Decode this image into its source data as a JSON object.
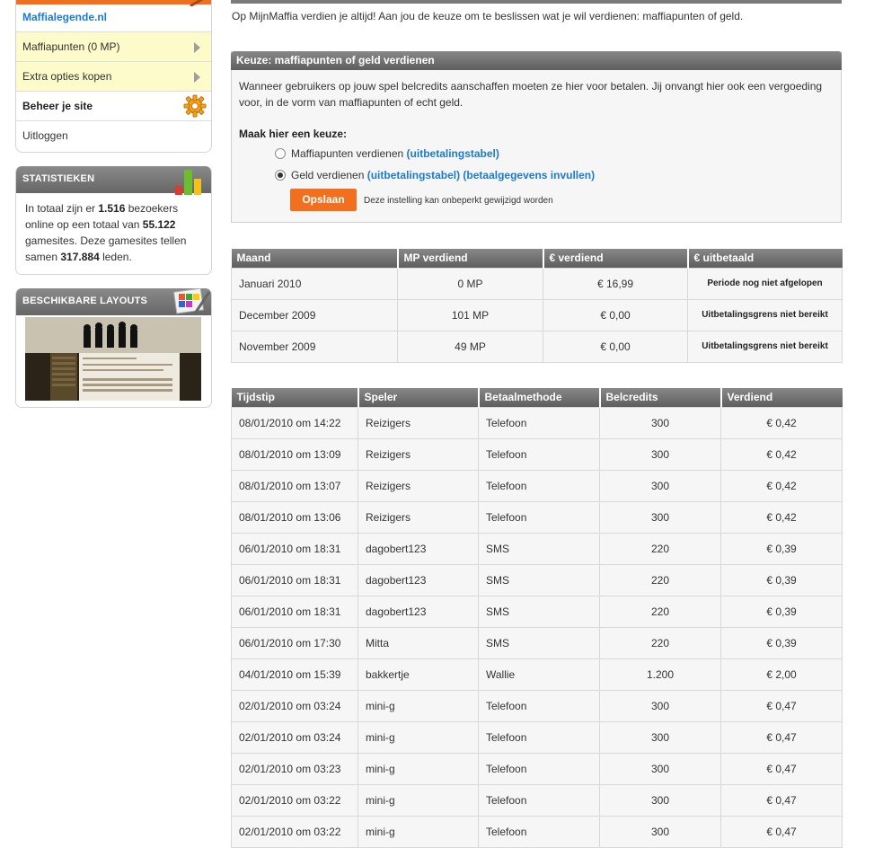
{
  "sidebar": {
    "site_name": "Maffialegende.nl",
    "nav": [
      {
        "label": "Maffiapunten (0 MP)",
        "style": "yellow",
        "icon": "arrow-right-icon"
      },
      {
        "label": "Extra opties kopen",
        "style": "yellow",
        "icon": "arrow-right-icon"
      },
      {
        "label": "Beheer je site",
        "style": "bold",
        "icon": "gear-icon"
      },
      {
        "label": "Uitloggen",
        "style": "plain",
        "icon": ""
      }
    ],
    "stats": {
      "title": "STATISTIEKEN",
      "t1": "In totaal zijn er ",
      "visitors": "1.516",
      "t2": " bezoekers online op een totaal van ",
      "sites": "55.122",
      "t3": " gamesites. Deze gamesites tellen samen ",
      "members": "317.884",
      "t4": " leden."
    },
    "layouts": {
      "title": "BESCHIKBARE LAYOUTS"
    }
  },
  "main": {
    "intro": "Op MijnMaffia verdien je altijd! Aan jou de keuze om te beslissen wat je wil verdienen: maffiapunten of geld.",
    "choice": {
      "title": "Keuze: maffiapunten of geld verdienen",
      "description": "Wanneer gebruikers op jouw spel belcredits aanschaffen moeten ze hier voor betalen. Jij onvangt hier ook een vergoeding voor, in de vorm van maffiapunten of echt geld.",
      "prompt": "Maak hier een keuze:",
      "option1_label": "Maffiapunten verdienen",
      "option1_link": "(uitbetalingstabel)",
      "option2_label": "Geld verdienen",
      "option2_link1": "(uitbetalingstabel)",
      "option2_link2": "(betaalgegevens invullen)",
      "selected": 2,
      "save_label": "Opslaan",
      "save_note": "Deze instelling kan onbeperkt gewijzigd worden"
    },
    "earnings": {
      "headers": [
        "Maand",
        "MP verdiend",
        "€ verdiend",
        "€ uitbetaald"
      ],
      "rows": [
        [
          "Januari 2010",
          "0 MP",
          "€ 16,99",
          "Periode nog niet afgelopen"
        ],
        [
          "December 2009",
          "101 MP",
          "€ 0,00",
          "Uitbetalingsgrens niet bereikt"
        ],
        [
          "November 2009",
          "49 MP",
          "€ 0,00",
          "Uitbetalingsgrens niet bereikt"
        ]
      ]
    },
    "transactions": {
      "headers": [
        "Tijdstip",
        "Speler",
        "Betaalmethode",
        "Belcredits",
        "Verdiend"
      ],
      "rows": [
        [
          "08/01/2010 om 14:22",
          "Reizigers",
          "Telefoon",
          "300",
          "€ 0,42"
        ],
        [
          "08/01/2010 om 13:09",
          "Reizigers",
          "Telefoon",
          "300",
          "€ 0,42"
        ],
        [
          "08/01/2010 om 13:07",
          "Reizigers",
          "Telefoon",
          "300",
          "€ 0,42"
        ],
        [
          "08/01/2010 om 13:06",
          "Reizigers",
          "Telefoon",
          "300",
          "€ 0,42"
        ],
        [
          "06/01/2010 om 18:31",
          "dagobert123",
          "SMS",
          "220",
          "€ 0,39"
        ],
        [
          "06/01/2010 om 18:31",
          "dagobert123",
          "SMS",
          "220",
          "€ 0,39"
        ],
        [
          "06/01/2010 om 18:31",
          "dagobert123",
          "SMS",
          "220",
          "€ 0,39"
        ],
        [
          "06/01/2010 om 17:30",
          "Mitta",
          "SMS",
          "220",
          "€ 0,39"
        ],
        [
          "04/01/2010 om 15:39",
          "bakkertje",
          "Wallie",
          "1.200",
          "€ 2,00"
        ],
        [
          "02/01/2010 om 03:24",
          "mini-g",
          "Telefoon",
          "300",
          "€ 0,47"
        ],
        [
          "02/01/2010 om 03:24",
          "mini-g",
          "Telefoon",
          "300",
          "€ 0,47"
        ],
        [
          "02/01/2010 om 03:23",
          "mini-g",
          "Telefoon",
          "300",
          "€ 0,47"
        ],
        [
          "02/01/2010 om 03:22",
          "mini-g",
          "Telefoon",
          "300",
          "€ 0,47"
        ],
        [
          "02/01/2010 om 03:22",
          "mini-g",
          "Telefoon",
          "300",
          "€ 0,47"
        ]
      ]
    }
  },
  "colors": {
    "accent": "#f0701e",
    "link": "#1a7ad4",
    "header": "#6e6e6e",
    "highlight": "#fdfbc9"
  }
}
